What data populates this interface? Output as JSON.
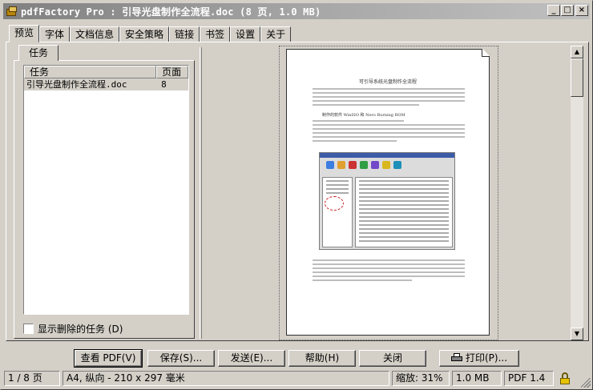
{
  "window": {
    "title": "pdfFactory Pro : 引导光盘制作全流程.doc (8 页, 1.0 MB)",
    "controls": {
      "minimize": "_",
      "maximize": "□",
      "close": "×"
    }
  },
  "tabs": [
    {
      "label": "预览",
      "active": true
    },
    {
      "label": "字体"
    },
    {
      "label": "文档信息"
    },
    {
      "label": "安全策略"
    },
    {
      "label": "链接"
    },
    {
      "label": "书签"
    },
    {
      "label": "设置"
    },
    {
      "label": "关于"
    }
  ],
  "tasks": {
    "tab_label": "任务",
    "columns": [
      "任务",
      "页面"
    ],
    "rows": [
      {
        "name": "引导光盘制作全流程.doc",
        "pages": "8"
      }
    ],
    "show_deleted_label": "显示删除的任务 (D)",
    "show_deleted_checked": false
  },
  "preview": {
    "doc_title": "可引导系统光盘制作全流程",
    "doc_subtitle": "制作的软件 WinISO 和 Nero Burning ROM"
  },
  "buttons": {
    "view_pdf": "查看 PDF(V)",
    "save": "保存(S)...",
    "send": "发送(E)...",
    "help": "帮助(H)",
    "close": "关闭",
    "print": "打印(P)..."
  },
  "status": {
    "page": "1 / 8 页",
    "paper": "A4, 纵向 - 210 x 297 毫米",
    "zoom": "缩放: 31%",
    "size": "1.0 MB",
    "pdf_version": "PDF 1.4"
  },
  "icons": {
    "app": "pdffactory-app-icon",
    "lock": "lock-icon",
    "printer": "printer-icon"
  }
}
